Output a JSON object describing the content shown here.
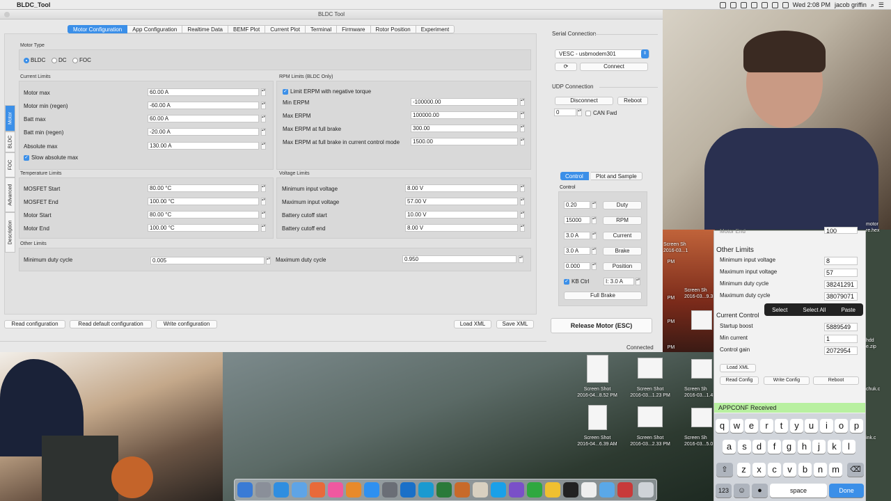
{
  "menubar": {
    "app_name": "BLDC_Tool",
    "clock": "Wed 2:08 PM",
    "user": "jacob griffin"
  },
  "window": {
    "title": "BLDC Tool",
    "status": "Connected"
  },
  "tabs": [
    "Motor Configuration",
    "App Configuration",
    "Realtime Data",
    "BEMF Plot",
    "Current Plot",
    "Terminal",
    "Firmware",
    "Rotor Position",
    "Experiment"
  ],
  "side_tabs": [
    "Motor",
    "BLDC",
    "FOC",
    "Advanced",
    "Description"
  ],
  "motor_type": {
    "label": "Motor Type",
    "options": [
      "BLDC",
      "DC",
      "FOC"
    ],
    "selected": "BLDC"
  },
  "current_limits": {
    "label": "Current Limits",
    "rows": [
      {
        "label": "Motor max",
        "value": "60.00 A"
      },
      {
        "label": "Motor min (regen)",
        "value": "-60.00 A"
      },
      {
        "label": "Batt max",
        "value": "60.00 A"
      },
      {
        "label": "Batt min (regen)",
        "value": "-20.00 A"
      },
      {
        "label": "Absolute max",
        "value": "130.00 A"
      }
    ],
    "slow_absolute_max": "Slow absolute max"
  },
  "rpm_limits": {
    "label": "RPM Limits (BLDC Only)",
    "check": "Limit ERPM with negative torque",
    "rows": [
      {
        "label": "Min ERPM",
        "value": "-100000.00"
      },
      {
        "label": "Max ERPM",
        "value": "100000.00"
      },
      {
        "label": "Max ERPM at full brake",
        "value": "300.00"
      },
      {
        "label": "Max ERPM at full brake in current control mode",
        "value": "1500.00"
      }
    ]
  },
  "temperature_limits": {
    "label": "Temperature Limits",
    "rows": [
      {
        "label": "MOSFET Start",
        "value": "80.00 °C"
      },
      {
        "label": "MOSFET End",
        "value": "100.00 °C"
      },
      {
        "label": "Motor Start",
        "value": "80.00 °C"
      },
      {
        "label": "Motor End",
        "value": "100.00 °C"
      }
    ]
  },
  "voltage_limits": {
    "label": "Voltage Limits",
    "rows": [
      {
        "label": "Minimum input voltage",
        "value": "8.00 V"
      },
      {
        "label": "Maximum input voltage",
        "value": "57.00 V"
      },
      {
        "label": "Battery cutoff start",
        "value": "10.00 V"
      },
      {
        "label": "Battery cutoff end",
        "value": "8.00 V"
      }
    ]
  },
  "other_limits": {
    "label": "Other Limits",
    "min_duty_label": "Minimum duty cycle",
    "min_duty": "0.005",
    "max_duty_label": "Maximum duty cycle",
    "max_duty": "0.950"
  },
  "bottom_buttons": [
    "Read configuration",
    "Read default configuration",
    "Write configuration",
    "Load XML",
    "Save XML"
  ],
  "serial": {
    "title": "Serial Connection",
    "port": "VESC - usbmodem301",
    "connect": "Connect"
  },
  "udp": {
    "title": "UDP Connection",
    "disconnect": "Disconnect",
    "reboot": "Reboot",
    "value": "0",
    "can_fwd": "CAN Fwd"
  },
  "control_tabs": [
    "Control",
    "Plot and Sample"
  ],
  "control": {
    "label": "Control",
    "rows": [
      {
        "value": "0.20",
        "button": "Duty"
      },
      {
        "value": "15000",
        "button": "RPM"
      },
      {
        "value": "3.0 A",
        "button": "Current"
      },
      {
        "value": "3.0 A",
        "button": "Brake"
      },
      {
        "value": "0.000",
        "button": "Position"
      }
    ],
    "kb_ctrl": "KB Ctrl",
    "kb_value": "I: 3.0 A",
    "full_brake": "Full Brake",
    "release": "Release Motor (ESC)"
  },
  "desktop": {
    "files": [
      {
        "name": "Screen Shot",
        "date": "2016-04...8.52 PM"
      },
      {
        "name": "Screen Shot",
        "date": "2016-03...1.23 PM"
      },
      {
        "name": "Screen Sh",
        "date": "2016-03...1.4"
      },
      {
        "name": "Screen Shot",
        "date": "2016-04...6.39 AM"
      },
      {
        "name": "Screen Shot",
        "date": "2016-03...2.33 PM"
      },
      {
        "name": "Screen Sh",
        "date": "2016-03...5.0"
      }
    ],
    "partial_labels": [
      "Screen Sh",
      "2016-03...9.3",
      "Screen Sh",
      "2016-03...1",
      "PM",
      "PM",
      "PM",
      "PM",
      "motor",
      "re.hex",
      "hdd",
      "e.zip",
      "chuk.c",
      "ink.c"
    ]
  },
  "phone": {
    "top_partial": "Motor End",
    "top_value": "100",
    "other_limits": "Other Limits",
    "rows": [
      {
        "label": "Minimum input voltage",
        "value": "8"
      },
      {
        "label": "Maximum input voltage",
        "value": "57"
      },
      {
        "label": "Minimum duty cycle",
        "value": "38241291"
      },
      {
        "label": "Maximum duty cycle",
        "value": "38079071"
      }
    ],
    "current_control": "Current Control",
    "cc_rows": [
      {
        "label": "Startup boost",
        "value": "5889549"
      },
      {
        "label": "Min current",
        "value": "1"
      },
      {
        "label": "Control gain",
        "value": "2072954"
      }
    ],
    "popup": [
      "Select",
      "Select All",
      "Paste"
    ],
    "load_xml": "Load XML",
    "buttons": [
      "Read Config",
      "Write Config",
      "Reboot"
    ],
    "banner": "APPCONF Received",
    "keys_row1": [
      "q",
      "w",
      "e",
      "r",
      "t",
      "y",
      "u",
      "i",
      "o",
      "p"
    ],
    "keys_row2": [
      "a",
      "s",
      "d",
      "f",
      "g",
      "h",
      "j",
      "k",
      "l"
    ],
    "keys_row3": [
      "z",
      "x",
      "c",
      "v",
      "b",
      "n",
      "m"
    ],
    "key_123": "123",
    "key_space": "space",
    "key_done": "Done"
  },
  "colors": {
    "accent": "#3b8fe8",
    "banner": "#b8f0a0"
  }
}
